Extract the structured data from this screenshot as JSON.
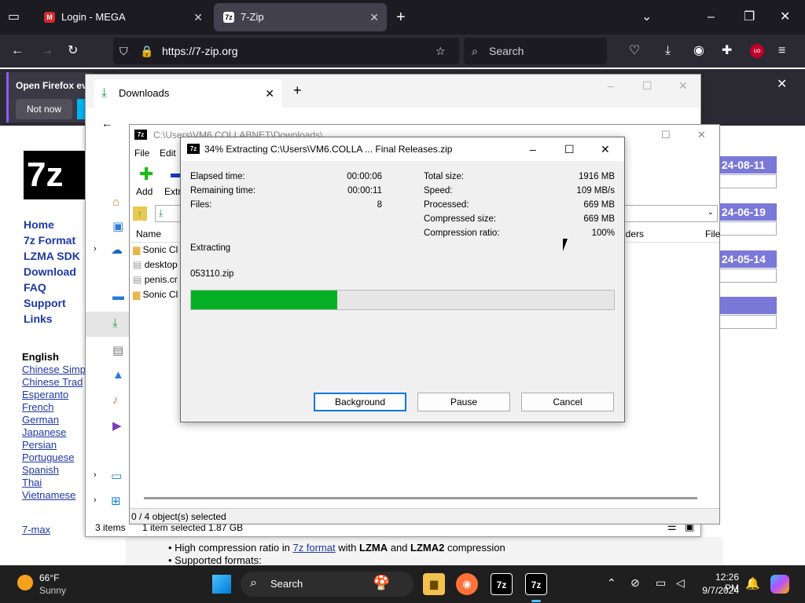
{
  "browser": {
    "tabs": [
      {
        "title": "Login - MEGA",
        "favicon": "M"
      },
      {
        "title": "7-Zip",
        "favicon": "7z"
      }
    ],
    "url": "https://7-zip.org",
    "search_placeholder": "Search",
    "notification": {
      "text": "Open Firefox ev",
      "not_now": "Not now"
    }
  },
  "site": {
    "logo": "7z",
    "nav": [
      "Home",
      "7z Format",
      "LZMA SDK",
      "Download",
      "FAQ",
      "Support",
      "Links"
    ],
    "lang_heading": "English",
    "languages": [
      "Chinese Simp",
      "Chinese Trad",
      "Esperanto",
      "French",
      "German",
      "Japanese",
      "Persian",
      "Portuguese",
      "Spanish",
      "Thai",
      "Vietnamese"
    ],
    "seven_max": "7-max",
    "dates": [
      "24-08-11",
      "24-06-19",
      "24-05-14"
    ],
    "bullets": [
      "High compression ratio in ",
      "7z format",
      " with ",
      "LZMA",
      " and ",
      "LZMA2",
      " compression"
    ],
    "bullet2": "Supported formats:"
  },
  "explorer": {
    "tab_title": "Downloads",
    "new_label": "Ne",
    "status_items": "3 items",
    "status_selected": "1 item selected  1.87 GB"
  },
  "filemanager": {
    "title": "C:\\Users\\VM6.COLLABNET\\Downloads\\",
    "menu": [
      "File",
      "Edit"
    ],
    "toolbar": [
      "Add",
      "Extra"
    ],
    "col_name": "Name",
    "col_folders": "lders",
    "col_file": "File",
    "files": [
      "Sonic Cl",
      "desktop",
      "penis.cr",
      "Sonic Cl"
    ],
    "status": "0 / 4 object(s) selected"
  },
  "dialog": {
    "title": "34% Extracting C:\\Users\\VM6.COLLA ... Final Releases.zip",
    "left": [
      {
        "label": "Elapsed time:",
        "value": "00:00:06"
      },
      {
        "label": "Remaining time:",
        "value": "00:00:11"
      },
      {
        "label": "Files:",
        "value": "8"
      }
    ],
    "right": [
      {
        "label": "Total size:",
        "value": "1916 MB"
      },
      {
        "label": "Speed:",
        "value": "109 MB/s"
      },
      {
        "label": "Processed:",
        "value": "669 MB"
      },
      {
        "label": "Compressed size:",
        "value": "669 MB"
      },
      {
        "label": "Compression ratio:",
        "value": "100%"
      }
    ],
    "status": "Extracting",
    "current_file": "053110.zip",
    "progress": 0.345,
    "buttons": {
      "background": "Background",
      "pause": "Pause",
      "cancel": "Cancel"
    }
  },
  "taskbar": {
    "weather_temp": "66°F",
    "weather_desc": "Sunny",
    "search": "Search",
    "time": "12:26 PM",
    "date": "9/7/2024",
    "seven_zip": "7z"
  },
  "colors": {
    "accent_green": "#06b025",
    "link_blue": "#1d38a6",
    "date_box": "#7a78d8"
  }
}
